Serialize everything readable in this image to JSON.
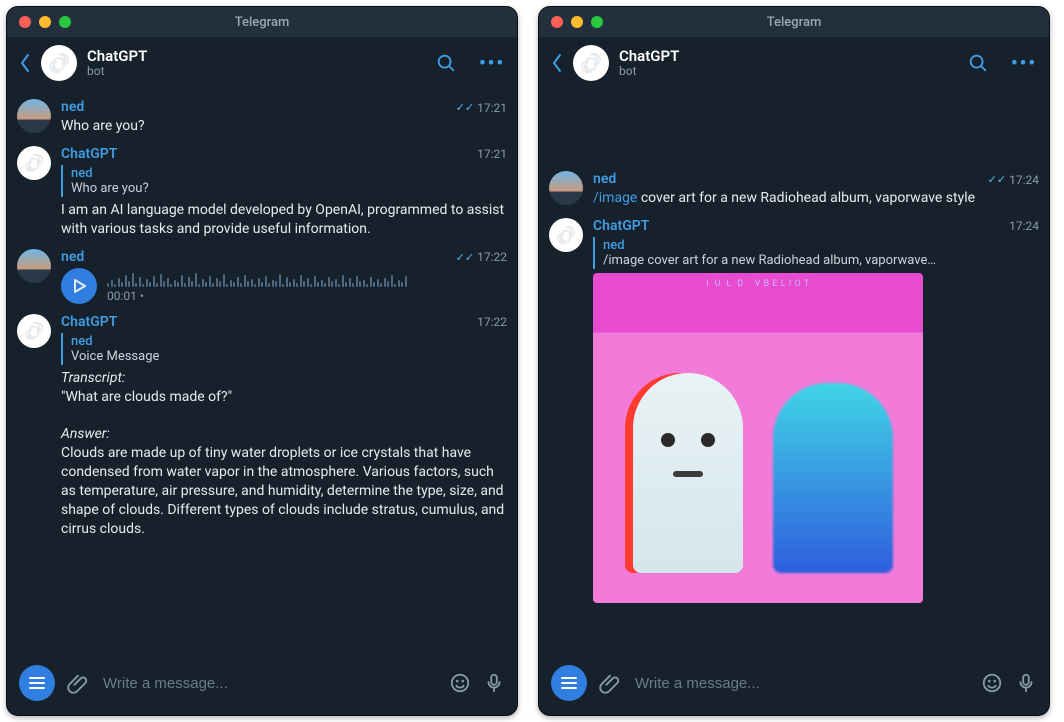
{
  "left": {
    "titlebar": "Telegram",
    "header": {
      "name": "ChatGPT",
      "sub": "bot"
    },
    "composer": {
      "placeholder": "Write a message..."
    },
    "messages": [
      {
        "kind": "text",
        "from": "user",
        "sender": "ned",
        "time": "17:21",
        "read": true,
        "text": "Who are you?"
      },
      {
        "kind": "reply-text",
        "from": "bot",
        "sender": "ChatGPT",
        "time": "17:21",
        "quote_sender": "ned",
        "quote_text": "Who are you?",
        "text": "I am an AI language model developed by OpenAI, programmed to assist with various tasks and provide useful information."
      },
      {
        "kind": "voice",
        "from": "user",
        "sender": "ned",
        "time": "17:22",
        "read": true,
        "duration": "00:01 •"
      },
      {
        "kind": "reply-transcript",
        "from": "bot",
        "sender": "ChatGPT",
        "time": "17:22",
        "quote_sender": "ned",
        "quote_text": "Voice Message",
        "transcript_label": "Transcript:",
        "transcript": "\"What are clouds made of?\"",
        "answer_label": "Answer:",
        "answer": "Clouds are made up of tiny water droplets or ice crystals that have condensed from water vapor in the atmosphere. Various factors, such as temperature, air pressure, and humidity, determine the type, size, and shape of clouds. Different types of clouds include stratus, cumulus, and cirrus clouds."
      }
    ]
  },
  "right": {
    "titlebar": "Telegram",
    "header": {
      "name": "ChatGPT",
      "sub": "bot"
    },
    "composer": {
      "placeholder": "Write a message..."
    },
    "messages": [
      {
        "kind": "cmd",
        "from": "user",
        "sender": "ned",
        "time": "17:24",
        "read": true,
        "cmd": "/image",
        "text": " cover art for a new Radiohead album, vaporwave style"
      },
      {
        "kind": "reply-image",
        "from": "bot",
        "sender": "ChatGPT",
        "time": "17:24",
        "quote_sender": "ned",
        "quote_text": "/image cover art for a new Radiohead album, vaporwave…"
      }
    ]
  }
}
